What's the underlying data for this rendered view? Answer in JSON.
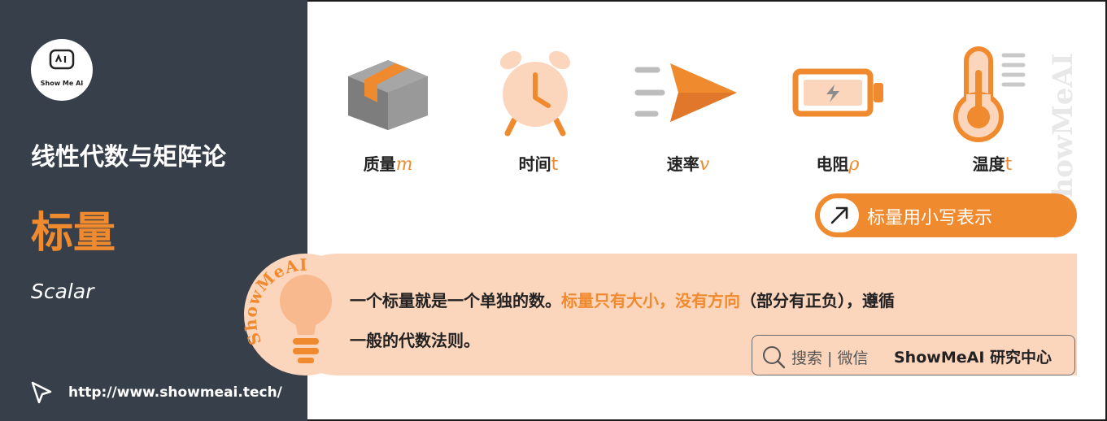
{
  "sidebar": {
    "logo_text": "Show Me AI",
    "course_title": "线性代数与矩阵论",
    "topic_title": "标量",
    "topic_subtitle": "Scalar",
    "url": "http://www.showmeai.tech/"
  },
  "icons": [
    {
      "name": "质量",
      "symbol": "m",
      "icon": "box-icon"
    },
    {
      "name": "时间",
      "symbol": "t",
      "icon": "alarm-clock-icon"
    },
    {
      "name": "速率",
      "symbol": "v",
      "icon": "paper-plane-icon"
    },
    {
      "name": "电阻",
      "symbol": "ρ",
      "icon": "battery-icon"
    },
    {
      "name": "温度",
      "symbol": "t",
      "icon": "thermometer-icon"
    }
  ],
  "watermark": "ShowMeAI",
  "badge": {
    "text": "标量用小写表示",
    "icon": "arrow-up-right-icon"
  },
  "description": {
    "watermark": "ShowMeAI",
    "part1": "一个标量就是一个单独的数。",
    "highlight1": "标量只有大小，没有方向",
    "part2": "（部分有正负），遵循",
    "line2": "一般的代数法则。"
  },
  "search": {
    "prefix": "搜索 | 微信",
    "brand": "ShowMeAI 研究中心",
    "icon": "search-icon"
  },
  "colors": {
    "accent": "#f08a2e",
    "panel": "#373f4a",
    "soft": "#fcd5bd",
    "gray": "#8c8c8c"
  }
}
